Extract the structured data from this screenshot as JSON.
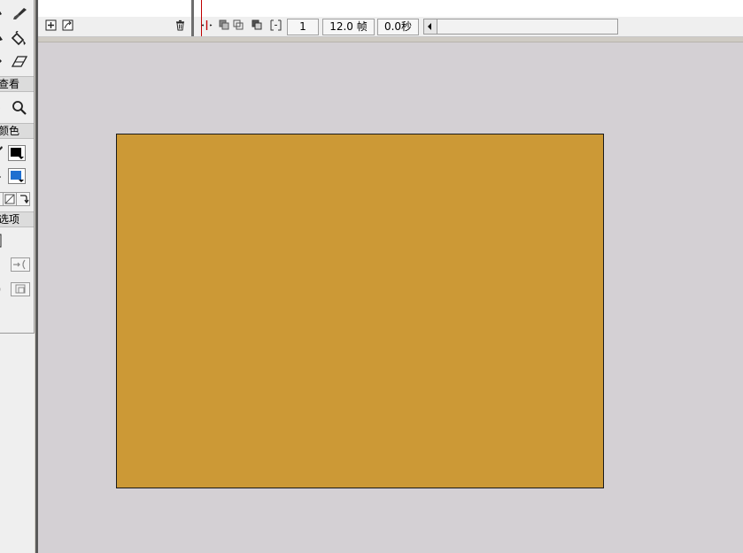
{
  "tools": {
    "sections": {
      "view": "查看",
      "colors": "颜色",
      "options": "选项"
    },
    "stroke_color": "#000000",
    "fill_color": "#1f6fd0"
  },
  "timeline": {
    "current_frame": "1",
    "frame_rate": "12.0 帧",
    "elapsed_time": "0.0秒"
  },
  "stage": {
    "background_color": "#cc9936"
  },
  "colors": {
    "workspace": "#d4d0d4",
    "panel": "#efefef",
    "playhead": "#c00000"
  }
}
